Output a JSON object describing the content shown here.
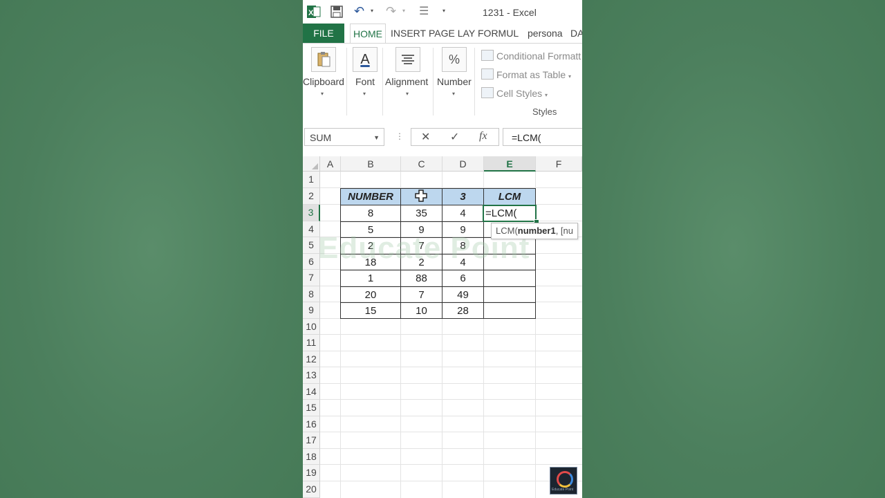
{
  "title_bar": {
    "doc_title": "1231 - Excel"
  },
  "tabs": {
    "file": "FILE",
    "items": [
      "HOME",
      "INSERT",
      "PAGE LAY",
      "FORMUL",
      "persona",
      "DA"
    ]
  },
  "ribbon": {
    "groups": [
      {
        "label": "Clipboard",
        "icon": "clipboard-icon"
      },
      {
        "label": "Font",
        "icon": "font-color-icon"
      },
      {
        "label": "Alignment",
        "icon": "align-icon"
      },
      {
        "label": "Number",
        "icon": "percent-icon"
      }
    ],
    "styles": {
      "conditional": "Conditional Formatt",
      "format_table": "Format as Table",
      "cell_styles": "Cell Styles",
      "label": "Styles"
    }
  },
  "formula_bar": {
    "name_box": "SUM",
    "formula": "=LCM(",
    "cancel": "✕",
    "enter": "✓",
    "fx": "fx"
  },
  "grid": {
    "columns": [
      "A",
      "B",
      "C",
      "D",
      "E",
      "F"
    ],
    "rows": [
      "1",
      "2",
      "3",
      "4",
      "5",
      "6",
      "7",
      "8",
      "9",
      "10",
      "11",
      "12",
      "13",
      "14",
      "15",
      "16",
      "17",
      "18",
      "19",
      "20"
    ],
    "header_row": [
      "NUMBER",
      "",
      "3",
      "LCM"
    ],
    "data_rows": [
      [
        "8",
        "35",
        "4"
      ],
      [
        "5",
        "9",
        "9"
      ],
      [
        "2",
        "7",
        "8"
      ],
      [
        "18",
        "2",
        "4"
      ],
      [
        "1",
        "88",
        "6"
      ],
      [
        "20",
        "7",
        "49"
      ],
      [
        "15",
        "10",
        "28"
      ]
    ],
    "active_cell_content": "=LCM(",
    "tooltip_fn": "LCM(",
    "tooltip_arg": "number1",
    "tooltip_rest": ", [nu"
  },
  "watermark": "Educate Point",
  "logo_text": "Educate Point"
}
